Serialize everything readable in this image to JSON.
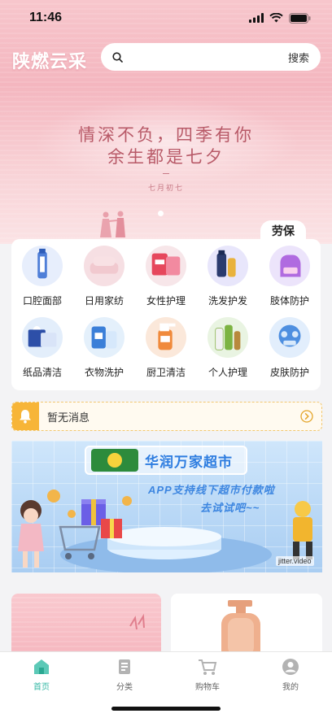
{
  "status_bar": {
    "time": "11:46"
  },
  "header": {
    "logo": "陕燃云采",
    "search_placeholder": "",
    "search_button": "搜索"
  },
  "banner": {
    "line1": "情深不负，四季有你",
    "line2": "余生都是七夕",
    "small": "七月初七"
  },
  "category_tag": "劳保",
  "categories": [
    {
      "label": "口腔面部",
      "icon": "toothpaste-icon",
      "color": "#e7eefc"
    },
    {
      "label": "日用家纺",
      "icon": "towel-icon",
      "color": "#f6dfe3"
    },
    {
      "label": "女性护理",
      "icon": "feminine-care-icon",
      "color": "#f7e6e9"
    },
    {
      "label": "洗发护发",
      "icon": "shampoo-icon",
      "color": "#e8e6fb"
    },
    {
      "label": "肢体防护",
      "icon": "glove-icon",
      "color": "#ece4fb"
    },
    {
      "label": "纸品清洁",
      "icon": "tissue-icon",
      "color": "#e3eefb"
    },
    {
      "label": "衣物洗护",
      "icon": "detergent-icon",
      "color": "#e4f0fb"
    },
    {
      "label": "厨卫清洁",
      "icon": "spray-bottle-icon",
      "color": "#fbe8da"
    },
    {
      "label": "个人护理",
      "icon": "lotion-icon",
      "color": "#e9f4e2"
    },
    {
      "label": "皮肤防护",
      "icon": "mask-icon",
      "color": "#e2eefc"
    }
  ],
  "notice": {
    "text": "暂无消息"
  },
  "promo": {
    "brand_logo_text": "华润万家",
    "brand_name": "华润万家超市",
    "line1": "APP支持线下超市付款啦",
    "line2": "去试试吧~~",
    "watermark": "jitter.video"
  },
  "tabbar": {
    "tabs": [
      {
        "label": "首页",
        "icon": "home-icon",
        "active": true
      },
      {
        "label": "分类",
        "icon": "category-icon",
        "active": false
      },
      {
        "label": "购物车",
        "icon": "cart-icon",
        "active": false
      },
      {
        "label": "我的",
        "icon": "profile-icon",
        "active": false
      }
    ]
  },
  "colors": {
    "accent": "#35b8a5",
    "notice_bell": "#f7b538",
    "promo_text": "#3d86e0"
  }
}
